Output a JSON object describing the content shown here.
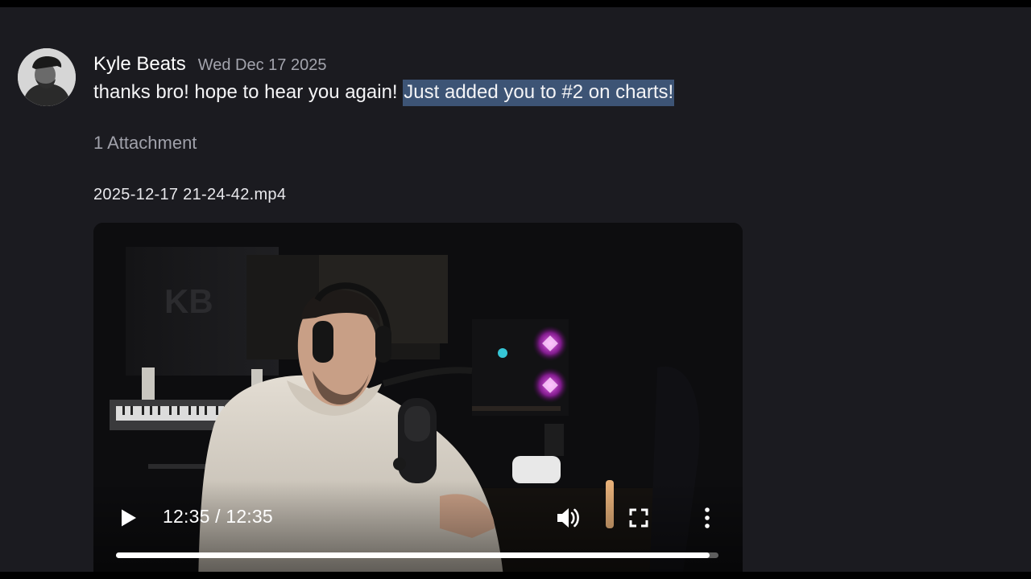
{
  "message": {
    "author": "Kyle Beats",
    "timestamp": "Wed Dec 17 2025",
    "text_plain": "thanks bro! hope to hear you again! ",
    "text_selected": "Just added you to #2 on charts!"
  },
  "attachments": {
    "count_label": "1 Attachment",
    "file_name": "2025-12-17 21-24-42.mp4"
  },
  "video_player": {
    "time_display": "12:35 / 12:35",
    "progress": 0.985,
    "wall_logo": "KB",
    "icons": {
      "play": "play-icon",
      "volume": "volume-icon",
      "fullscreen": "fullscreen-icon",
      "more": "more-vertical-icon"
    }
  },
  "colors": {
    "background": "#1b1b20",
    "selection_highlight": "#3d5475",
    "muted_text": "#a3a4ad"
  }
}
